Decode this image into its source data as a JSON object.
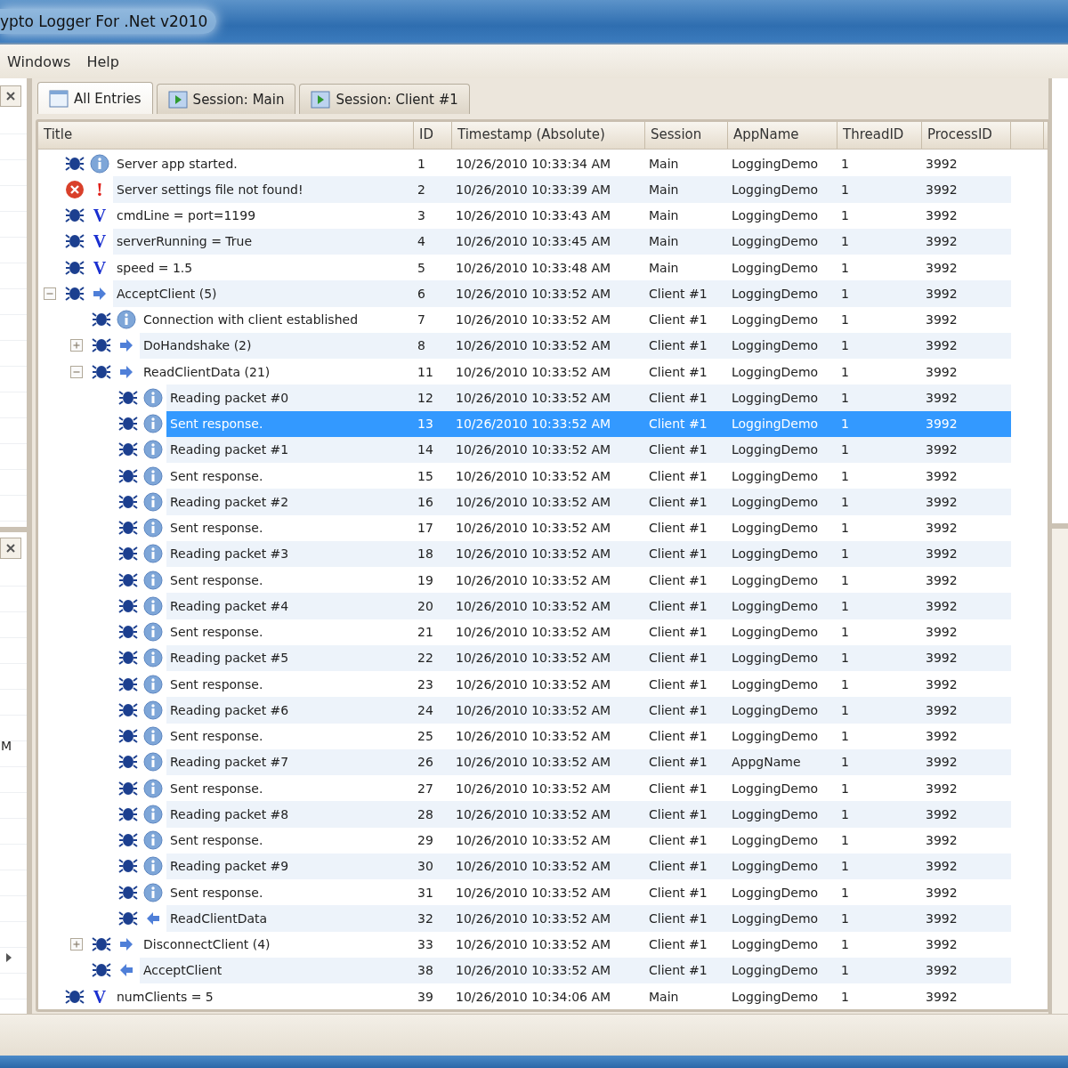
{
  "window": {
    "title": "ypto Logger For .Net v2010"
  },
  "menu": [
    "Windows",
    "Help"
  ],
  "left_panel": {
    "fragment": "M"
  },
  "tabs": [
    {
      "label": "All Entries",
      "selected": true,
      "kind": "all"
    },
    {
      "label": "Session: Main",
      "selected": false,
      "kind": "session"
    },
    {
      "label": "Session: Client #1",
      "selected": false,
      "kind": "session"
    }
  ],
  "table": {
    "columns": [
      "Title",
      "ID",
      "Timestamp (Absolute)",
      "Session",
      "AppName",
      "ThreadID",
      "ProcessID"
    ],
    "rows": [
      {
        "kind": "info",
        "title": "Server app started.",
        "id": "1",
        "timestamp": "10/26/2010 10:33:34 AM",
        "session": "Main",
        "app_name": "LoggingDemo",
        "thread_id": "1",
        "process_id": "3992",
        "selected": false
      },
      {
        "kind": "error",
        "glyph": "!",
        "title": "Server settings file not found!",
        "id": "2",
        "timestamp": "10/26/2010 10:33:39 AM",
        "session": "Main",
        "app_name": "LoggingDemo",
        "thread_id": "1",
        "process_id": "3992",
        "selected": false
      },
      {
        "kind": "variable",
        "glyph": "V",
        "title": "cmdLine = port=1199",
        "id": "3",
        "timestamp": "10/26/2010 10:33:43 AM",
        "session": "Main",
        "app_name": "LoggingDemo",
        "thread_id": "1",
        "process_id": "3992",
        "selected": false
      },
      {
        "kind": "variable",
        "glyph": "V",
        "title": "serverRunning = True",
        "id": "4",
        "timestamp": "10/26/2010 10:33:45 AM",
        "session": "Main",
        "app_name": "LoggingDemo",
        "thread_id": "1",
        "process_id": "3992",
        "selected": false
      },
      {
        "kind": "variable",
        "glyph": "V",
        "title": "speed = 1.5",
        "id": "5",
        "timestamp": "10/26/2010 10:33:48 AM",
        "session": "Main",
        "app_name": "LoggingDemo",
        "thread_id": "1",
        "process_id": "3992",
        "selected": false
      },
      {
        "kind": "enter",
        "title": "AcceptClient (5)",
        "id": "6",
        "timestamp": "10/26/2010 10:33:52 AM",
        "session": "Client #1",
        "app_name": "LoggingDemo",
        "thread_id": "1",
        "process_id": "3992",
        "selected": false,
        "expanded": true,
        "children": [
          {
            "kind": "info",
            "title": "Connection with client established",
            "id": "7",
            "timestamp": "10/26/2010 10:33:52 AM",
            "session": "Client #1",
            "app_name": "LoggingDemo",
            "thread_id": "1",
            "process_id": "3992",
            "selected": false
          },
          {
            "kind": "enter",
            "title": "DoHandshake (2)",
            "id": "8",
            "timestamp": "10/26/2010 10:33:52 AM",
            "session": "Client #1",
            "app_name": "LoggingDemo",
            "thread_id": "1",
            "process_id": "3992",
            "selected": false,
            "expanded": false
          },
          {
            "kind": "enter",
            "title": "ReadClientData (21)",
            "id": "11",
            "timestamp": "10/26/2010 10:33:52 AM",
            "session": "Client #1",
            "app_name": "LoggingDemo",
            "thread_id": "1",
            "process_id": "3992",
            "selected": false,
            "expanded": true,
            "children": [
              {
                "kind": "info",
                "title": "Reading packet #0",
                "id": "12",
                "timestamp": "10/26/2010 10:33:52 AM",
                "session": "Client #1",
                "app_name": "LoggingDemo",
                "thread_id": "1",
                "process_id": "3992",
                "selected": false
              },
              {
                "kind": "info",
                "title": "Sent response.",
                "id": "13",
                "timestamp": "10/26/2010 10:33:52 AM",
                "session": "Client #1",
                "app_name": "LoggingDemo",
                "thread_id": "1",
                "process_id": "3992",
                "selected": true
              },
              {
                "kind": "info",
                "title": "Reading packet #1",
                "id": "14",
                "timestamp": "10/26/2010 10:33:52 AM",
                "session": "Client #1",
                "app_name": "LoggingDemo",
                "thread_id": "1",
                "process_id": "3992",
                "selected": false
              },
              {
                "kind": "info",
                "title": "Sent response.",
                "id": "15",
                "timestamp": "10/26/2010 10:33:52 AM",
                "session": "Client #1",
                "app_name": "LoggingDemo",
                "thread_id": "1",
                "process_id": "3992",
                "selected": false
              },
              {
                "kind": "info",
                "title": "Reading packet #2",
                "id": "16",
                "timestamp": "10/26/2010 10:33:52 AM",
                "session": "Client #1",
                "app_name": "LoggingDemo",
                "thread_id": "1",
                "process_id": "3992",
                "selected": false
              },
              {
                "kind": "info",
                "title": "Sent response.",
                "id": "17",
                "timestamp": "10/26/2010 10:33:52 AM",
                "session": "Client #1",
                "app_name": "LoggingDemo",
                "thread_id": "1",
                "process_id": "3992",
                "selected": false
              },
              {
                "kind": "info",
                "title": "Reading packet #3",
                "id": "18",
                "timestamp": "10/26/2010 10:33:52 AM",
                "session": "Client #1",
                "app_name": "LoggingDemo",
                "thread_id": "1",
                "process_id": "3992",
                "selected": false
              },
              {
                "kind": "info",
                "title": "Sent response.",
                "id": "19",
                "timestamp": "10/26/2010 10:33:52 AM",
                "session": "Client #1",
                "app_name": "LoggingDemo",
                "thread_id": "1",
                "process_id": "3992",
                "selected": false
              },
              {
                "kind": "info",
                "title": "Reading packet #4",
                "id": "20",
                "timestamp": "10/26/2010 10:33:52 AM",
                "session": "Client #1",
                "app_name": "LoggingDemo",
                "thread_id": "1",
                "process_id": "3992",
                "selected": false
              },
              {
                "kind": "info",
                "title": "Sent response.",
                "id": "21",
                "timestamp": "10/26/2010 10:33:52 AM",
                "session": "Client #1",
                "app_name": "LoggingDemo",
                "thread_id": "1",
                "process_id": "3992",
                "selected": false
              },
              {
                "kind": "info",
                "title": "Reading packet #5",
                "id": "22",
                "timestamp": "10/26/2010 10:33:52 AM",
                "session": "Client #1",
                "app_name": "LoggingDemo",
                "thread_id": "1",
                "process_id": "3992",
                "selected": false
              },
              {
                "kind": "info",
                "title": "Sent response.",
                "id": "23",
                "timestamp": "10/26/2010 10:33:52 AM",
                "session": "Client #1",
                "app_name": "LoggingDemo",
                "thread_id": "1",
                "process_id": "3992",
                "selected": false
              },
              {
                "kind": "info",
                "title": "Reading packet #6",
                "id": "24",
                "timestamp": "10/26/2010 10:33:52 AM",
                "session": "Client #1",
                "app_name": "LoggingDemo",
                "thread_id": "1",
                "process_id": "3992",
                "selected": false
              },
              {
                "kind": "info",
                "title": "Sent response.",
                "id": "25",
                "timestamp": "10/26/2010 10:33:52 AM",
                "session": "Client #1",
                "app_name": "LoggingDemo",
                "thread_id": "1",
                "process_id": "3992",
                "selected": false
              },
              {
                "kind": "info",
                "title": "Reading packet #7",
                "id": "26",
                "timestamp": "10/26/2010 10:33:52 AM",
                "session": "Client #1",
                "app_name": "AppgName",
                "thread_id": "1",
                "process_id": "3992",
                "selected": false
              },
              {
                "kind": "info",
                "title": "Sent response.",
                "id": "27",
                "timestamp": "10/26/2010 10:33:52 AM",
                "session": "Client #1",
                "app_name": "LoggingDemo",
                "thread_id": "1",
                "process_id": "3992",
                "selected": false
              },
              {
                "kind": "info",
                "title": "Reading packet #8",
                "id": "28",
                "timestamp": "10/26/2010 10:33:52 AM",
                "session": "Client #1",
                "app_name": "LoggingDemo",
                "thread_id": "1",
                "process_id": "3992",
                "selected": false
              },
              {
                "kind": "info",
                "title": "Sent response.",
                "id": "29",
                "timestamp": "10/26/2010 10:33:52 AM",
                "session": "Client #1",
                "app_name": "LoggingDemo",
                "thread_id": "1",
                "process_id": "3992",
                "selected": false
              },
              {
                "kind": "info",
                "title": "Reading packet #9",
                "id": "30",
                "timestamp": "10/26/2010 10:33:52 AM",
                "session": "Client #1",
                "app_name": "LoggingDemo",
                "thread_id": "1",
                "process_id": "3992",
                "selected": false
              },
              {
                "kind": "info",
                "title": "Sent response.",
                "id": "31",
                "timestamp": "10/26/2010 10:33:52 AM",
                "session": "Client #1",
                "app_name": "LoggingDemo",
                "thread_id": "1",
                "process_id": "3992",
                "selected": false
              },
              {
                "kind": "leave",
                "title": "ReadClientData",
                "id": "32",
                "timestamp": "10/26/2010 10:33:52 AM",
                "session": "Client #1",
                "app_name": "LoggingDemo",
                "thread_id": "1",
                "process_id": "3992",
                "selected": false
              }
            ]
          },
          {
            "kind": "enter",
            "title": "DisconnectClient (4)",
            "id": "33",
            "timestamp": "10/26/2010 10:33:52 AM",
            "session": "Client #1",
            "app_name": "LoggingDemo",
            "thread_id": "1",
            "process_id": "3992",
            "selected": false,
            "expanded": false
          },
          {
            "kind": "leave",
            "title": "AcceptClient",
            "id": "38",
            "timestamp": "10/26/2010 10:33:52 AM",
            "session": "Client #1",
            "app_name": "LoggingDemo",
            "thread_id": "1",
            "process_id": "3992",
            "selected": false
          }
        ]
      },
      {
        "kind": "variable",
        "glyph": "V",
        "title": "numClients = 5",
        "id": "39",
        "timestamp": "10/26/2010 10:34:06 AM",
        "session": "Main",
        "app_name": "LoggingDemo",
        "thread_id": "1",
        "process_id": "3992",
        "selected": false
      }
    ]
  }
}
